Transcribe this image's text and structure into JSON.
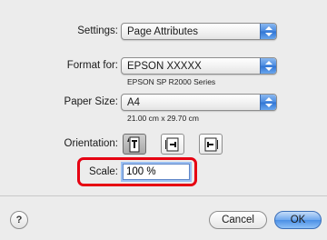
{
  "settings": {
    "label": "Settings:",
    "value": "Page Attributes"
  },
  "format": {
    "label": "Format for:",
    "value": "EPSON XXXXX",
    "subtitle": "EPSON SP R2000 Series"
  },
  "paper": {
    "label": "Paper Size:",
    "value": "A4",
    "subtitle": "21.00 cm x 29.70 cm"
  },
  "orientation": {
    "label": "Orientation:",
    "options": [
      "portrait",
      "landscape-left",
      "landscape-right"
    ],
    "selected": "portrait"
  },
  "scale": {
    "label": "Scale:",
    "value": "100 %"
  },
  "buttons": {
    "help": "?",
    "cancel": "Cancel",
    "ok": "OK"
  },
  "colors": {
    "highlight": "#e60012",
    "accent": "#4a8be0"
  }
}
